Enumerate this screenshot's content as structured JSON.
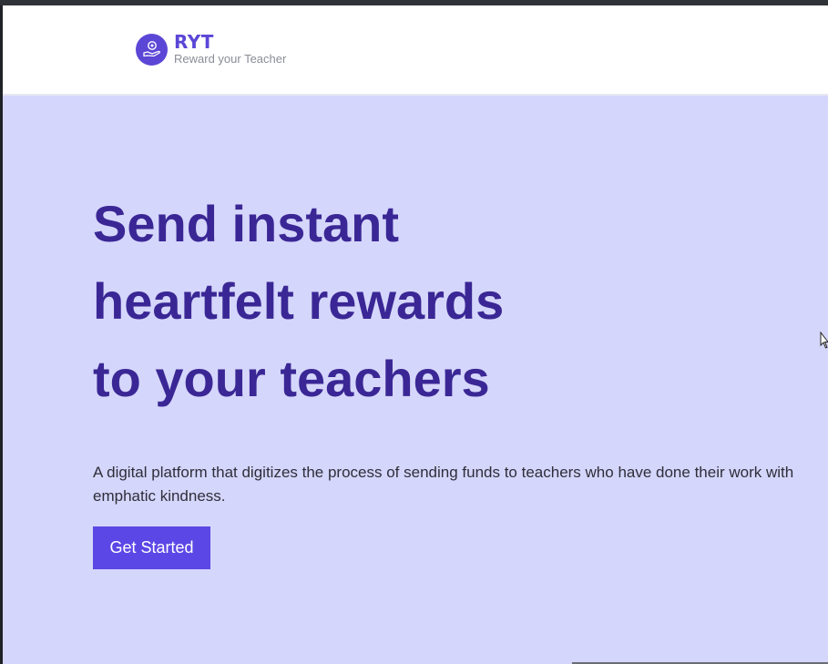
{
  "header": {
    "brand_name": "RYT",
    "brand_tagline": "Reward your Teacher",
    "logo_icon": "hand-coin-icon"
  },
  "hero": {
    "title_lines": [
      "Send instant",
      "heartfelt rewards",
      "to your teachers"
    ],
    "description": "A digital platform that digitizes the process of sending funds to teachers who have done their work with emphatic kindness.",
    "cta_label": "Get Started"
  },
  "colors": {
    "brand": "#5b47d6",
    "hero_background": "#d5d6fb",
    "title": "#3a2795",
    "button": "#5b47e6"
  }
}
